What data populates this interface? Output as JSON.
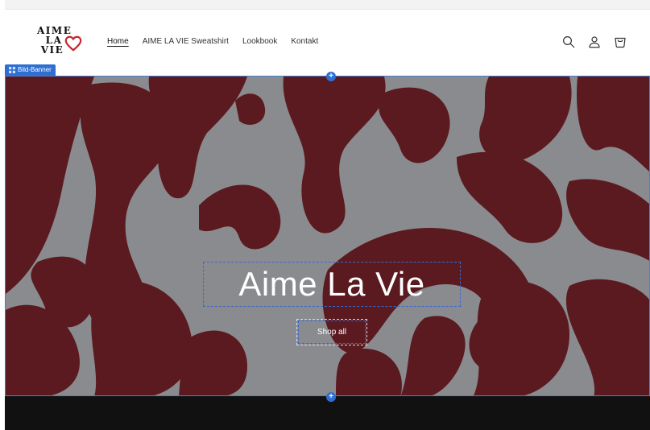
{
  "header": {
    "logo": {
      "line1": "AIME",
      "line2": "LA",
      "line3": "VIE",
      "heart_color": "#c4262e"
    },
    "nav": [
      {
        "label": "Home",
        "active": true
      },
      {
        "label": "AIME LA VIE Sweatshirt",
        "active": false
      },
      {
        "label": "Lookbook",
        "active": false
      },
      {
        "label": "Kontakt",
        "active": false
      }
    ],
    "icons": [
      "search-icon",
      "account-icon",
      "cart-icon"
    ]
  },
  "editor": {
    "section_label": "Bild-Banner",
    "add_section_symbol": "+"
  },
  "banner": {
    "title": "Aime La Vie",
    "button_label": "Shop all",
    "pattern_color": "#5b1a1f",
    "background_color": "#8a8b8f"
  },
  "colors": {
    "accent": "#2f6fd1",
    "footer": "#111111"
  }
}
